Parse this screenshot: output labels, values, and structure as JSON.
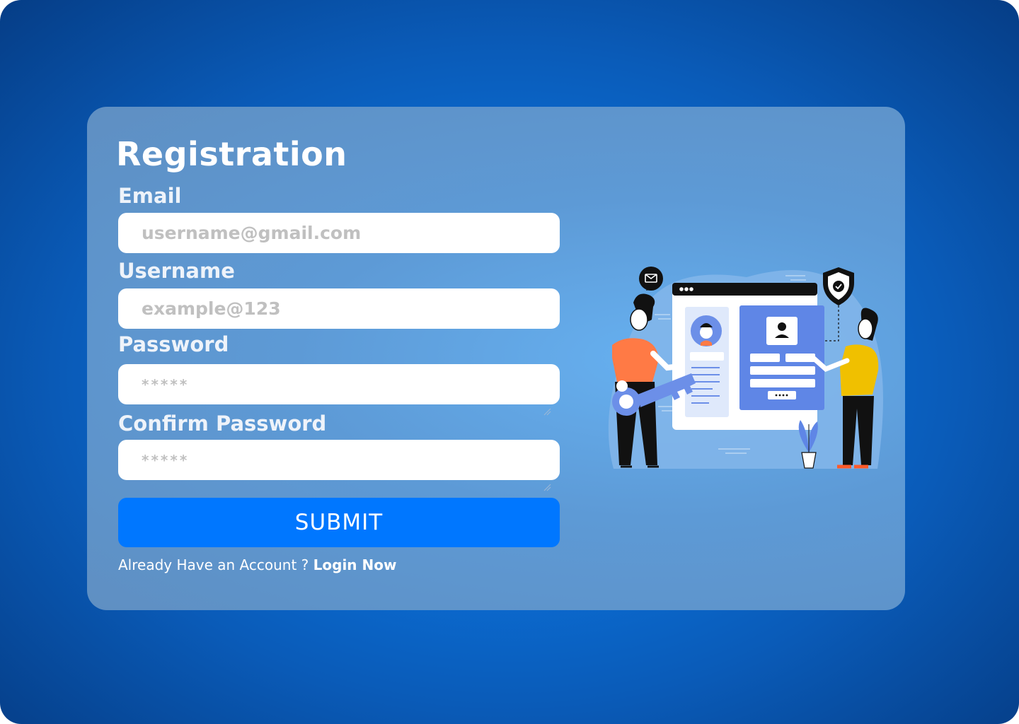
{
  "form": {
    "title": "Registration",
    "email": {
      "label": "Email",
      "placeholder": "username@gmail.com",
      "value": ""
    },
    "username": {
      "label": "Username",
      "placeholder": "example@123",
      "value": ""
    },
    "password": {
      "label": "Password",
      "placeholder": "*****",
      "value": ""
    },
    "confirm_password": {
      "label": "Confirm Password",
      "placeholder": "*****",
      "value": ""
    },
    "submit_label": "SUBMIT",
    "footer_text": "Already Have an Account ? ",
    "login_link": "Login Now"
  },
  "illustration": {
    "icons": [
      "mail-icon",
      "shield-check-icon",
      "key-icon",
      "user-profile-icon",
      "plant-icon"
    ]
  },
  "colors": {
    "accent": "#0077ff",
    "background": "#0a5bb8",
    "card": "#5d9ad6"
  }
}
